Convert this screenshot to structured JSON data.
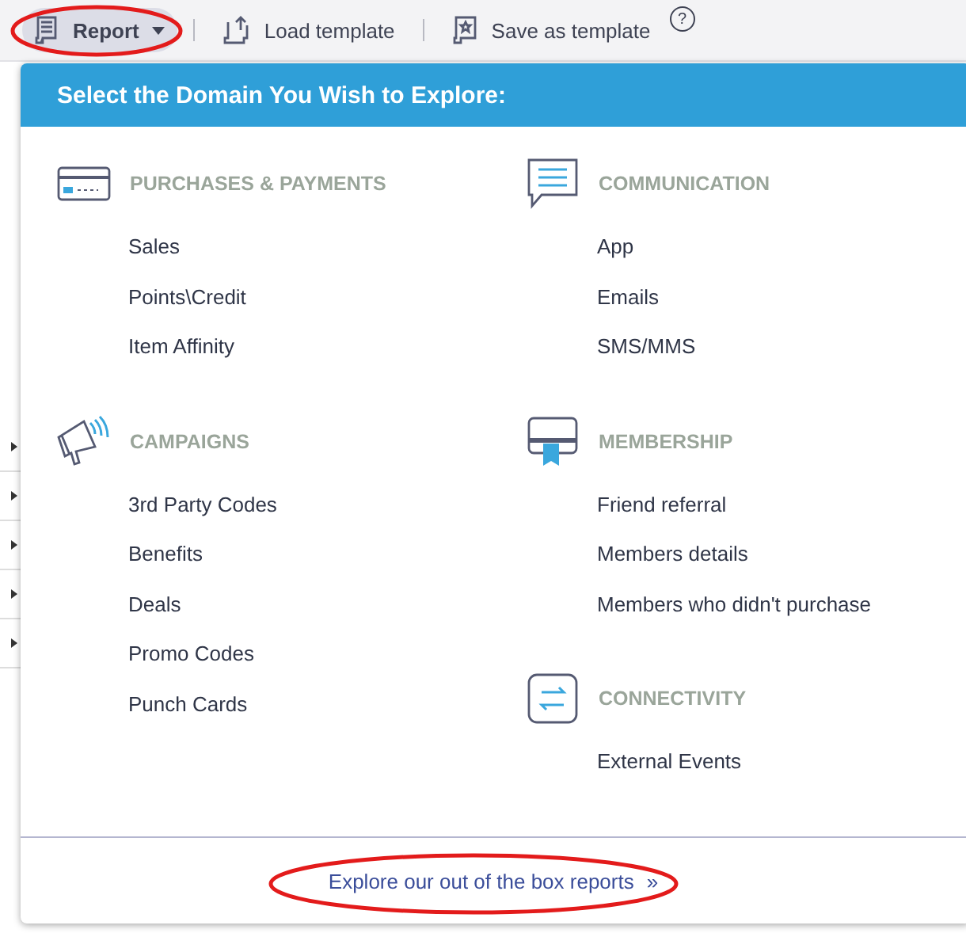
{
  "toolbar": {
    "buttons": [
      {
        "kind": "report",
        "label": "Report",
        "selected": true
      },
      {
        "kind": "load",
        "label": "Load template",
        "selected": false
      },
      {
        "kind": "save",
        "label": "Save as template",
        "selected": false
      }
    ],
    "help": "?"
  },
  "dropdown": {
    "title": "Select the Domain You Wish to Explore:",
    "columns": [
      [
        {
          "kind": "card",
          "title": "PURCHASES & PAYMENTS",
          "items": [
            "Sales",
            "Points\\Credit",
            "Item Affinity"
          ]
        },
        {
          "kind": "megaphone",
          "title": "CAMPAIGNS",
          "items": [
            "3rd Party Codes",
            "Benefits",
            "Deals",
            "Promo Codes",
            "Punch Cards"
          ]
        }
      ],
      [
        {
          "kind": "chat",
          "title": "COMMUNICATION",
          "items": [
            "App",
            "Emails",
            "SMS/MMS"
          ]
        },
        {
          "kind": "membership",
          "title": "MEMBERSHIP",
          "items": [
            "Friend referral",
            "Members details",
            "Members who didn't purchase"
          ]
        },
        {
          "kind": "connectivity",
          "title": "CONNECTIVITY",
          "items": [
            "External Events"
          ]
        }
      ]
    ],
    "footer_link": {
      "label": "Explore our out of the box reports",
      "arrow": "»"
    }
  }
}
